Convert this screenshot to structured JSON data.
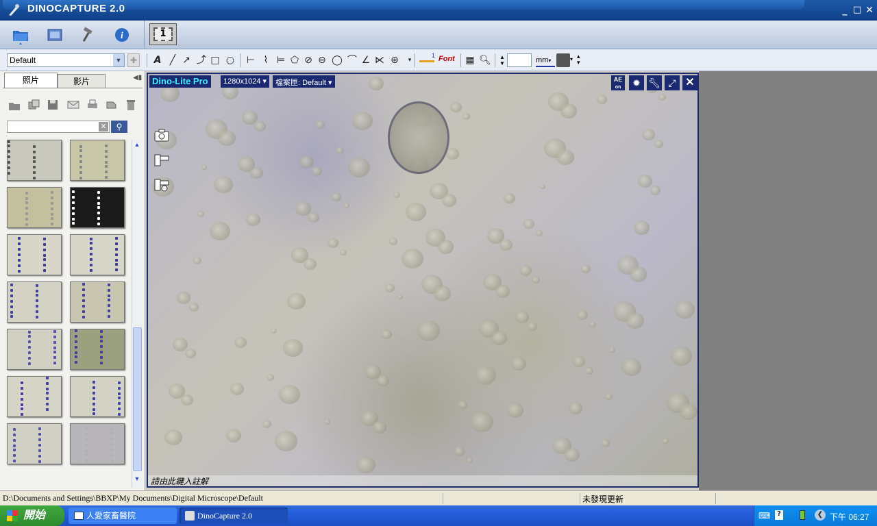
{
  "window": {
    "title": "DINOCAPTURE 2.0",
    "minimize": "_",
    "maximize": "□",
    "close": "✕"
  },
  "toolbar1": {
    "items": [
      "open-folder-icon",
      "image-view-icon",
      "tools-icon",
      "info-icon",
      "single-view-icon"
    ],
    "view_count": "1"
  },
  "toolbar2": {
    "profile_select": "Default",
    "font_label": "Font",
    "stroke_width": "1",
    "unit": "mm"
  },
  "left_panel": {
    "tabs": [
      "照片",
      "影片"
    ],
    "search_placeholder": "",
    "thumbs": [
      {
        "bg": "#c9c9bd",
        "dots": "#555"
      },
      {
        "bg": "#c8c6a8",
        "dots": "#888"
      },
      {
        "bg": "#c3c0a0",
        "dots": "#999"
      },
      {
        "bg": "#1a1a1a",
        "dots": "#fff"
      },
      {
        "bg": "#d8d6c8",
        "dots": "#3a3a9a"
      },
      {
        "bg": "#d8d6c8",
        "dots": "#3a3a9a"
      },
      {
        "bg": "#d4d2c4",
        "dots": "#4040a0"
      },
      {
        "bg": "#c8c6b0",
        "dots": "#4040a0"
      },
      {
        "bg": "#d2d0c2",
        "dots": "#5050b0"
      },
      {
        "bg": "#9aa080",
        "dots": "#4040a0"
      },
      {
        "bg": "#d6d4c6",
        "dots": "#4040a8"
      },
      {
        "bg": "#d4d2c4",
        "dots": "#4040a8"
      },
      {
        "bg": "#d2d0c4",
        "dots": "#5050b0"
      },
      {
        "bg": "#b8b6b8",
        "dots": "#b0b0b8"
      }
    ]
  },
  "preview": {
    "camera_name": "Dino-Lite Pro",
    "resolution": "1280x1024",
    "profile": "檔案匣: Default",
    "ae_label": "AE",
    "ae_state": "on",
    "annotation_hint": "請由此鍵入註解"
  },
  "status": {
    "path": "D:\\Documents and Settings\\BBXP\\My Documents\\Digital Microscope\\Default",
    "update": "未發現更新"
  },
  "taskbar": {
    "start": "開始",
    "tasks": [
      "人愛家畜醫院",
      "DinoCapture 2.0"
    ],
    "clock": "下午 06:27"
  }
}
